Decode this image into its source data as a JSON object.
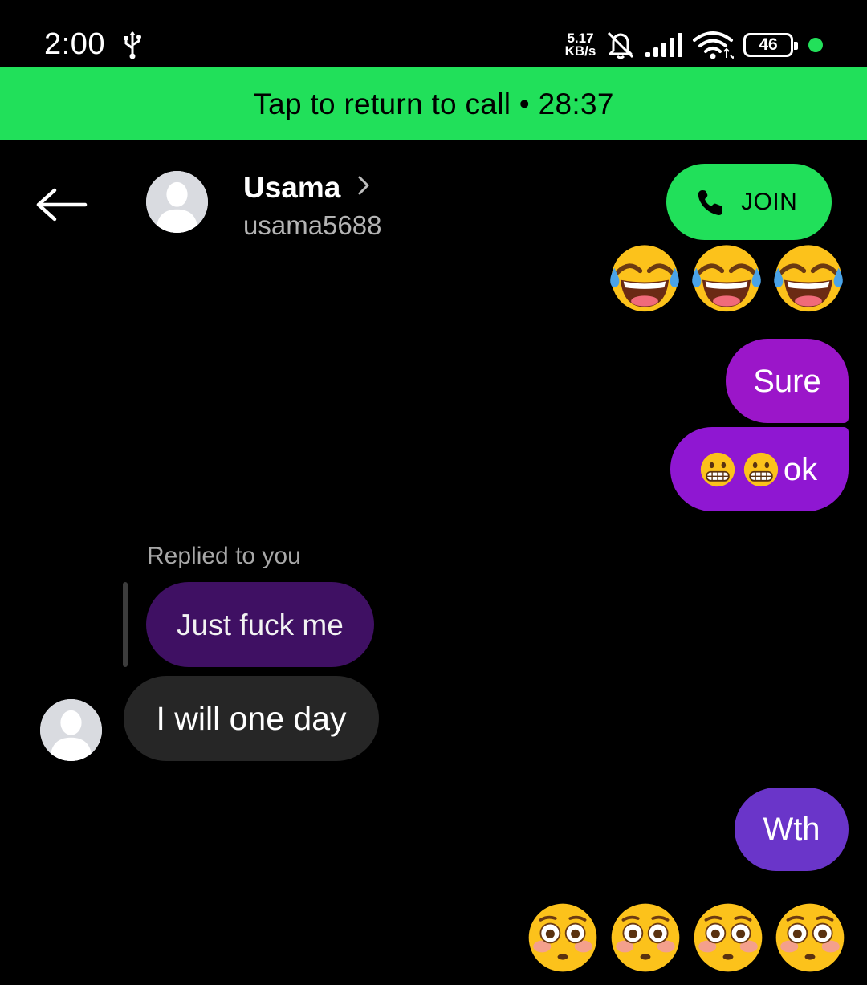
{
  "status_bar": {
    "time": "2:00",
    "net_speed_value": "5.17",
    "net_speed_unit": "KB/s",
    "battery": "46",
    "icons": [
      "usb-icon",
      "bell-off-icon",
      "signal-icon",
      "wifi-icon",
      "battery-icon"
    ]
  },
  "call_banner": {
    "text": "Tap to return to call • 28:37"
  },
  "header": {
    "name": "Usama",
    "username": "usama5688",
    "join_label": "JOIN"
  },
  "messages": {
    "sent_emojis_laugh": [
      "tears-of-joy-emoji",
      "tears-of-joy-emoji",
      "tears-of-joy-emoji"
    ],
    "sent_sure": "Sure",
    "sent_ok": "ok",
    "sent_ok_emojis": [
      "grimacing-face-emoji",
      "grimacing-face-emoji"
    ],
    "replied_label": "Replied to you",
    "quoted_message": "Just fuck me",
    "received_message": "I will one day",
    "sent_wth": "Wth",
    "sent_emojis_flushed": [
      "flushed-face-emoji",
      "flushed-face-emoji",
      "flushed-face-emoji",
      "flushed-face-emoji"
    ]
  },
  "colors": {
    "accent_green": "#21e05a",
    "sent_bubble_1": "#9b16c9",
    "sent_bubble_2": "#8f17d2",
    "sent_bubble_3": "#6a35c9",
    "quoted_bubble": "#3f1063",
    "received_bubble": "#262626"
  }
}
